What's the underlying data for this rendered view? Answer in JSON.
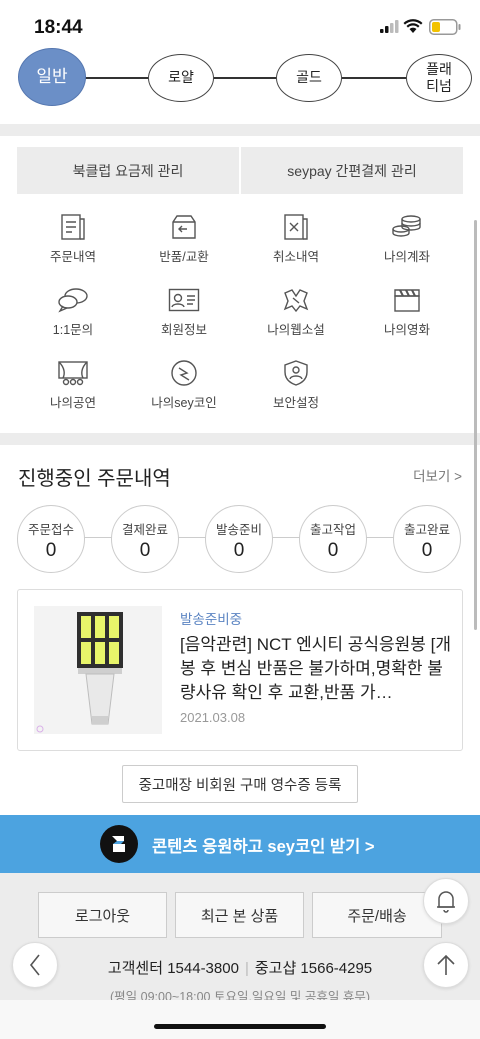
{
  "status_bar": {
    "time": "18:44"
  },
  "tiers": [
    "일반",
    "로얄",
    "골드",
    "플래\n티넘"
  ],
  "tabs": [
    "북클럽 요금제 관리",
    "seypay 간편결제 관리"
  ],
  "menu": [
    {
      "label": "주문내역",
      "icon": "order-list-icon"
    },
    {
      "label": "반품/교환",
      "icon": "return-box-icon"
    },
    {
      "label": "취소내역",
      "icon": "cancel-doc-icon"
    },
    {
      "label": "나의계좌",
      "icon": "coins-icon"
    },
    {
      "label": "1:1문의",
      "icon": "chat-bubbles-icon"
    },
    {
      "label": "회원정보",
      "icon": "id-card-icon"
    },
    {
      "label": "나의웹소설",
      "icon": "book-icon"
    },
    {
      "label": "나의영화",
      "icon": "clapperboard-icon"
    },
    {
      "label": "나의공연",
      "icon": "theater-icon"
    },
    {
      "label": "나의sey코인",
      "icon": "sey-coin-icon"
    },
    {
      "label": "보안설정",
      "icon": "shield-user-icon"
    }
  ],
  "orders": {
    "title": "진행중인 주문내역",
    "more": "더보기 >",
    "steps": [
      {
        "label": "주문접수",
        "count": "0"
      },
      {
        "label": "결제완료",
        "count": "0"
      },
      {
        "label": "발송준비",
        "count": "0"
      },
      {
        "label": "출고작업",
        "count": "0"
      },
      {
        "label": "출고완료",
        "count": "0"
      }
    ],
    "item": {
      "status": "발송준비중",
      "name": "[음악관련] NCT 엔시티 공식응원봉 [개봉 후 변심 반품은 불가하며,명확한 불량사유 확인 후 교환,반품 가…",
      "date": "2021.03.08"
    },
    "receipt_button": "중고매장 비회원 구매 영수증 등록"
  },
  "banner": {
    "text": "콘텐츠 응원하고 sey코인 받기 >",
    "color": "#4ca3e0"
  },
  "footer": {
    "buttons": [
      "로그아웃",
      "최근 본 상품",
      "주문/배송"
    ],
    "cs_label": "고객센터 1544-3800",
    "shop_label": "중고샵 1566-4295",
    "hours": "(평일 09:00~18:00 토요일,일요일 및 공휴일 휴무)"
  },
  "accent_color": "#6b8fc7"
}
